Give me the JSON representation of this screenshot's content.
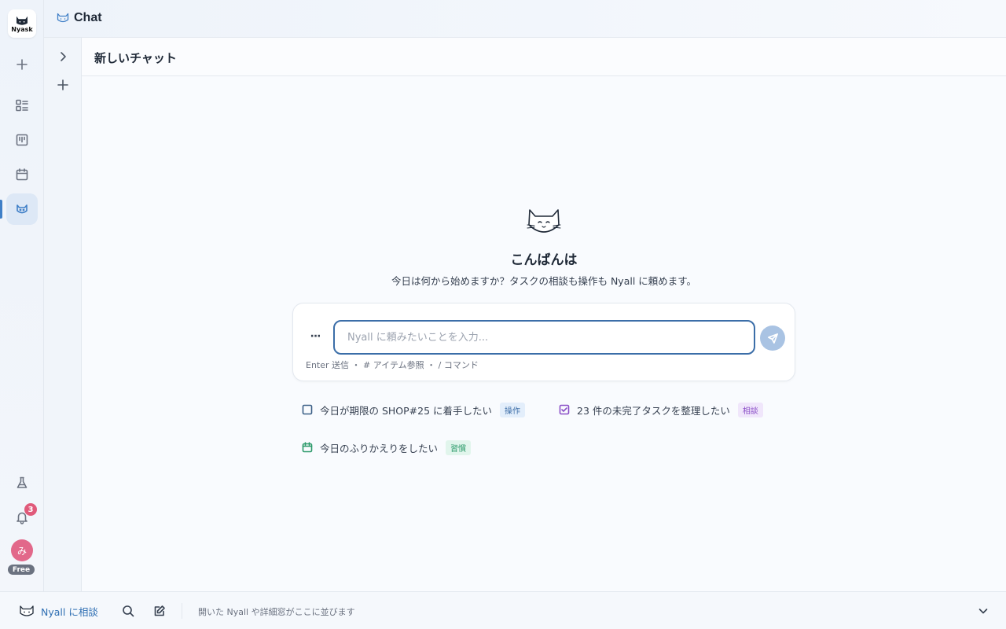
{
  "app": {
    "logo_text": "Nyask",
    "page_title": "Chat",
    "plan_badge": "Free",
    "notification_count": "3",
    "avatar_initial": "み"
  },
  "rail": {
    "items": [
      {
        "name": "new",
        "icon": "plus-icon"
      },
      {
        "name": "list",
        "icon": "list-icon"
      },
      {
        "name": "board",
        "icon": "kanban-icon"
      },
      {
        "name": "calendar",
        "icon": "calendar-icon"
      },
      {
        "name": "chat",
        "icon": "cat-icon",
        "active": true
      }
    ],
    "bottom": [
      {
        "name": "labs",
        "icon": "flask-icon"
      },
      {
        "name": "notifications",
        "icon": "bell-icon"
      }
    ]
  },
  "chat": {
    "title": "新しいチャット",
    "greeting": "こんばんは",
    "subtitle": "今日は何から始めますか？タスクの相談も操作も Nyall に頼めます。",
    "input_placeholder": "Nyall に頼みたいことを入力...",
    "input_value": "",
    "more_label": "···",
    "hint": "Enter 送信 ・ # アイテム参照 ・ / コマンド"
  },
  "suggestions": [
    {
      "text": "今日が期限の SHOP#25 に着手したい",
      "tag": "操作",
      "icon": "checkbox-icon"
    },
    {
      "text": "23 件の未完了タスクを整理したい",
      "tag": "相談",
      "icon": "checked-box-icon"
    },
    {
      "text": "今日のふりかえりをしたい",
      "tag": "習慣",
      "icon": "calendar-icon"
    }
  ],
  "bottombar": {
    "ask_label": "Nyall に相談",
    "empty_text": "開いた Nyall や詳細窓がここに並びます"
  },
  "colors": {
    "accent": "#3f7fc7",
    "tag_operation": "#3f6fa8",
    "tag_consult": "#8a4fc7",
    "tag_habit": "#2c9a6a",
    "badge": "#e05a7a"
  }
}
